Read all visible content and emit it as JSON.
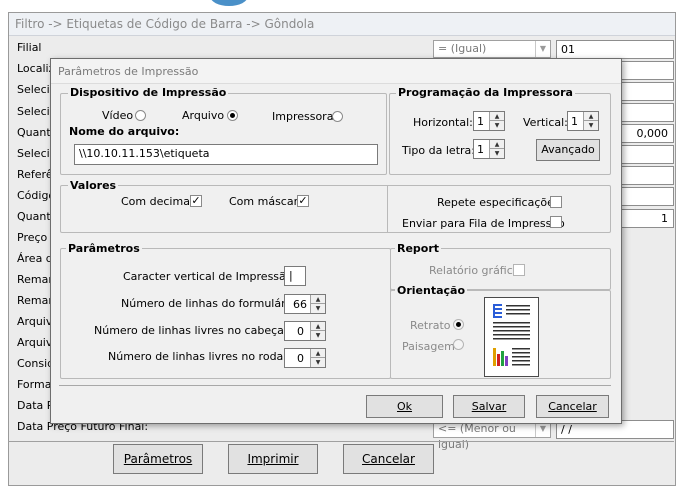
{
  "background_window": {
    "title": "Filtro -> Etiquetas de Código de Barra -> Gôndola",
    "labels": [
      "Filial",
      "Localiz",
      "Selecio",
      "Selecio",
      "Quant.",
      "Selecio",
      "Referê",
      "Código",
      "Quanti",
      "Preço (",
      "Área d",
      "Remarc",
      "Remarc",
      "Arquivo",
      "Arquivo",
      "Conside",
      "Forma",
      "Data Pr",
      "Data Preço Futuro Final:"
    ],
    "filial_operator": "= (Igual)",
    "filial_value": "01",
    "quant_value": "0,000",
    "quantidade_value": "1",
    "data_final_operator": "<= (Menor ou igual)",
    "data_final_value": "/ /",
    "buttons": {
      "parametros": "Parâmetros",
      "imprimir": "Imprimir",
      "cancelar": "Cancelar"
    }
  },
  "dialog": {
    "title": "Parâmetros de Impressão",
    "dispositivo": {
      "legend": "Dispositivo de Impressão",
      "options": [
        {
          "label": "Vídeo",
          "selected": false
        },
        {
          "label": "Arquivo",
          "selected": true
        },
        {
          "label": "Impressora",
          "selected": false
        }
      ],
      "file_label": "Nome do arquivo:",
      "file_value": "\\\\10.10.11.153\\etiqueta"
    },
    "programacao": {
      "legend": "Programação da Impressora",
      "horizontal_label": "Horizontal:",
      "horizontal_value": "1",
      "vertical_label": "Vertical:",
      "vertical_value": "1",
      "tipo_letra_label": "Tipo da letra:",
      "tipo_letra_value": "1",
      "avancado_button": "Avançado"
    },
    "valores": {
      "legend": "Valores",
      "com_decimais_label": "Com decimais",
      "com_decimais_checked": true,
      "com_mascara_label": "Com máscara",
      "com_mascara_checked": true,
      "repete_label": "Repete especificações",
      "repete_checked": false,
      "enviar_fila_label": "Enviar para Fila de Impressão",
      "enviar_fila_checked": false
    },
    "parametros": {
      "legend": "Parâmetros",
      "caracter_vertical_label": "Caracter vertical de Impressão:",
      "caracter_vertical_value": "|",
      "num_linhas_form_label": "Número de linhas do formulário:",
      "num_linhas_form_value": "66",
      "num_linhas_cab_label": "Número de linhas livres no cabeçalho:",
      "num_linhas_cab_value": "0",
      "num_linhas_rod_label": "Número de linhas livres no rodapé:",
      "num_linhas_rod_value": "0"
    },
    "report": {
      "legend": "Report",
      "relatorio_grafico_label": "Relatório gráfico",
      "relatorio_grafico_checked": false
    },
    "orientacao": {
      "legend": "Orientação",
      "retrato_label": "Retrato",
      "retrato_selected": true,
      "paisagem_label": "Paisagem",
      "paisagem_selected": false
    },
    "buttons": {
      "ok": "Ok",
      "salvar": "Salvar",
      "cancelar": "Cancelar"
    }
  },
  "colors": {
    "dialog_bg": "#f0f0f0",
    "border": "#7a7a7a",
    "disabled_text": "#8a8a8a",
    "icon_blue": "#2a5dd8"
  },
  "icons": [
    "dropdown-arrow-icon",
    "spinner-up-icon",
    "spinner-down-icon",
    "portrait-page-icon",
    "checkmark-icon"
  ]
}
